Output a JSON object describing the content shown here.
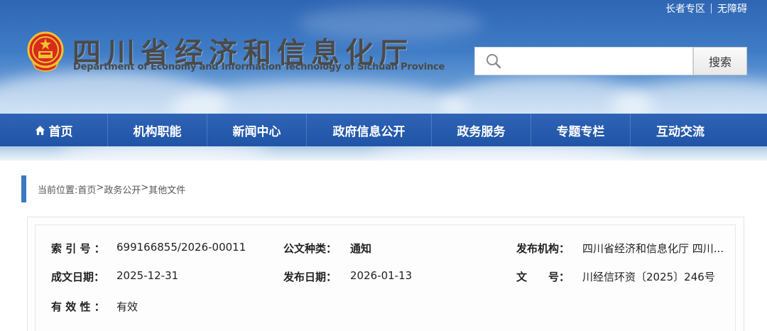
{
  "header": {
    "top_links": [
      "长者专区",
      "无障碍"
    ],
    "title": "四川省经济和信息化厅",
    "subtitle": "Department of Economy and Information Technology of Sichuan Province",
    "emblem_icon": "national-emblem-icon",
    "search": {
      "placeholder": "",
      "value": "",
      "button_label": "搜索",
      "icon": "search-icon"
    }
  },
  "nav": {
    "items": [
      {
        "label": "首页",
        "icon": "home-icon"
      },
      {
        "label": "机构职能"
      },
      {
        "label": "新闻中心"
      },
      {
        "label": "政府信息公开"
      },
      {
        "label": "政务服务"
      },
      {
        "label": "专题专栏"
      },
      {
        "label": "互动交流"
      }
    ]
  },
  "breadcrumb": {
    "prefix": "当前位置:",
    "items": [
      "首页",
      "政务公开",
      "其他文件"
    ],
    "separator": ">"
  },
  "doc_info": {
    "index_label": "索 引 号 ：",
    "index_value": "699166855/2026-00011",
    "category_label": "公文种类：",
    "category_value": "通知",
    "publisher_label": "发布机构：",
    "publisher_value": "四川省经济和信息化厅 四川...",
    "created_label": "成文日期：",
    "created_value": "2025-12-31",
    "published_label": "发布日期：",
    "published_value": "2026-01-13",
    "docno_label": "文　　号：",
    "docno_value": "川经信环资〔2025〕246号",
    "validity_label": "有 效 性 ：",
    "validity_value": "有效"
  },
  "colors": {
    "header_blue": "#3f7cc6",
    "nav_blue": "#2459a8",
    "accent": "#3b78c2"
  }
}
